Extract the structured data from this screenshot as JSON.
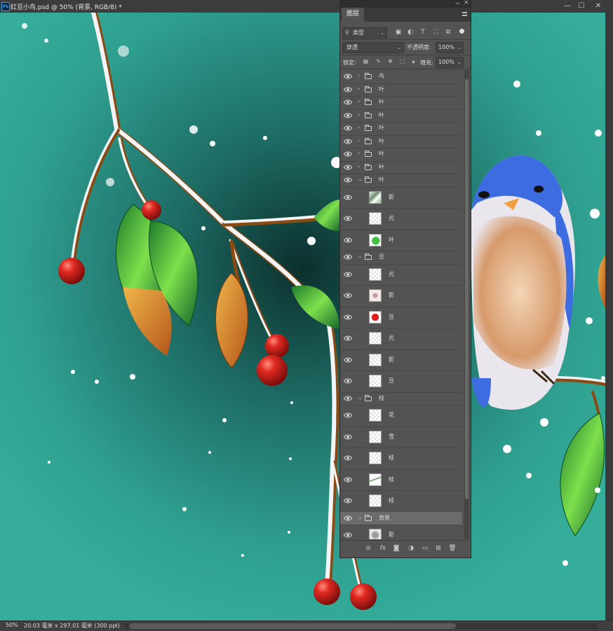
{
  "window": {
    "app_icon": "photoshop-icon",
    "document_title": "红豆小鸟.psd @ 50% (背景, RGB/8) *",
    "controls": [
      "minimize-icon",
      "maximize-icon",
      "close-icon"
    ]
  },
  "status": {
    "zoom": "50%",
    "doc_size": "20.03 毫米 x 297.01 毫米 (300 ppi)",
    "arrow": "›"
  },
  "layers_panel": {
    "tab_label": "图层",
    "filter_label": "类型",
    "blend_mode": "穿透",
    "opacity_label": "不透明度:",
    "opacity_value": "100%",
    "lock_label": "锁定:",
    "fill_label": "填充:",
    "fill_value": "100%",
    "filter_icons": [
      "image-filter-icon",
      "adjustment-filter-icon",
      "text-filter-icon",
      "shape-filter-icon",
      "smart-object-filter-icon"
    ],
    "lock_icons": [
      "lock-transparent-icon",
      "lock-pixels-icon",
      "lock-position-icon",
      "lock-artboard-icon",
      "lock-all-icon"
    ],
    "bottom_icons": [
      "link-layers-icon",
      "fx-icon",
      "add-mask-icon",
      "adjustment-layer-icon",
      "new-group-icon",
      "new-layer-icon",
      "delete-layer-icon"
    ],
    "layers": [
      {
        "type": "group",
        "name": "鸟",
        "expanded": false
      },
      {
        "type": "group",
        "name": "叶",
        "expanded": false
      },
      {
        "type": "group",
        "name": "叶",
        "expanded": false
      },
      {
        "type": "group",
        "name": "叶",
        "expanded": false
      },
      {
        "type": "group",
        "name": "叶",
        "expanded": false
      },
      {
        "type": "group",
        "name": "叶",
        "expanded": false
      },
      {
        "type": "group",
        "name": "叶",
        "expanded": false
      },
      {
        "type": "group",
        "name": "叶",
        "expanded": false
      },
      {
        "type": "group",
        "name": "叶",
        "expanded": true
      },
      {
        "type": "layer",
        "name": "影",
        "thumb": "leaf-shadow"
      },
      {
        "type": "layer",
        "name": "光",
        "thumb": "blank"
      },
      {
        "type": "layer",
        "name": "叶",
        "thumb": "leaf"
      },
      {
        "type": "group",
        "name": "豆",
        "expanded": true
      },
      {
        "type": "layer",
        "name": "光",
        "thumb": "blank"
      },
      {
        "type": "layer",
        "name": "影",
        "thumb": "berry-shadow"
      },
      {
        "type": "layer",
        "name": "豆",
        "thumb": "berry"
      },
      {
        "type": "layer",
        "name": "光",
        "thumb": "blank"
      },
      {
        "type": "layer",
        "name": "影",
        "thumb": "blank"
      },
      {
        "type": "layer",
        "name": "豆",
        "thumb": "blank"
      },
      {
        "type": "group",
        "name": "枝",
        "expanded": true
      },
      {
        "type": "layer",
        "name": "花",
        "thumb": "blank"
      },
      {
        "type": "layer",
        "name": "雪",
        "thumb": "blank"
      },
      {
        "type": "layer",
        "name": "枝",
        "thumb": "blank"
      },
      {
        "type": "layer",
        "name": "枝",
        "thumb": "branch"
      },
      {
        "type": "layer",
        "name": "枝",
        "thumb": "blank"
      },
      {
        "type": "group",
        "name": "背景",
        "expanded": true,
        "selected": true
      },
      {
        "type": "layer",
        "name": "影",
        "thumb": "bg-shadow"
      }
    ]
  },
  "colors": {
    "canvas_bg": "#2f9f90",
    "berry": "#c8201c",
    "leaf": "#3fa83a",
    "bird_blue": "#3d6be0",
    "panel_bg": "#535353",
    "selected_row": "#6b6b6b"
  }
}
